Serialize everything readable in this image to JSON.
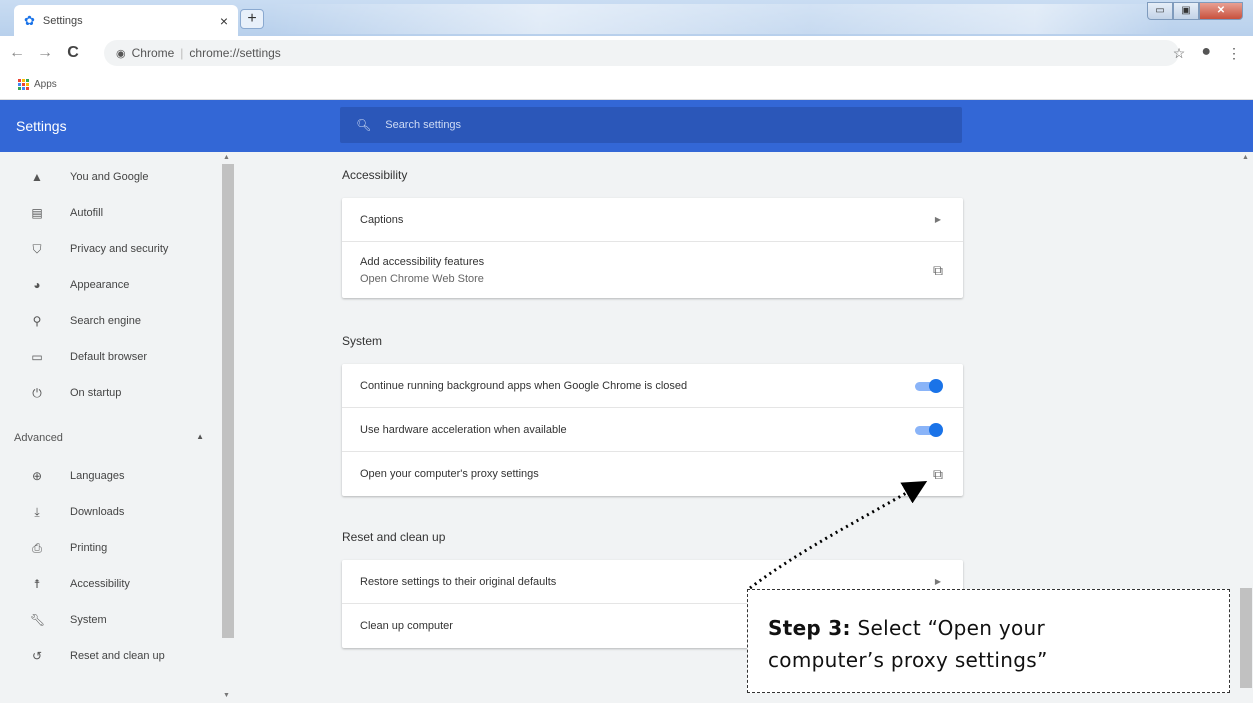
{
  "browser": {
    "tab": {
      "icon": "gear-icon",
      "title": "Settings",
      "close": "×"
    },
    "new_tab": "+",
    "window_buttons": {
      "minimize": "▭",
      "maximize": "▣",
      "close": "✕"
    },
    "toolbar": {
      "back": "←",
      "forward": "→",
      "reload": "C",
      "site_chip": "Chrome",
      "url": "chrome://settings",
      "bookmark_icon": "star-icon",
      "profile_icon": "account-icon",
      "menu_icon": "more-vert-icon"
    },
    "bookmarks": {
      "apps_label": "Apps"
    }
  },
  "header": {
    "title": "Settings",
    "search_placeholder": "Search settings"
  },
  "sidebar": {
    "items": [
      {
        "label": "You and Google",
        "icon": "person-icon"
      },
      {
        "label": "Autofill",
        "icon": "clipboard-icon"
      },
      {
        "label": "Privacy and security",
        "icon": "shield-icon"
      },
      {
        "label": "Appearance",
        "icon": "palette-icon"
      },
      {
        "label": "Search engine",
        "icon": "search-icon"
      },
      {
        "label": "Default browser",
        "icon": "browser-icon"
      },
      {
        "label": "On startup",
        "icon": "power-icon"
      }
    ],
    "advanced_label": "Advanced",
    "advanced_items": [
      {
        "label": "Languages",
        "icon": "globe-icon"
      },
      {
        "label": "Downloads",
        "icon": "download-icon"
      },
      {
        "label": "Printing",
        "icon": "printer-icon"
      },
      {
        "label": "Accessibility",
        "icon": "accessibility-icon"
      },
      {
        "label": "System",
        "icon": "wrench-icon"
      },
      {
        "label": "Reset and clean up",
        "icon": "restore-icon"
      }
    ]
  },
  "main": {
    "accessibility": {
      "title": "Accessibility",
      "captions": "Captions",
      "add_features": "Add accessibility features",
      "add_features_sub": "Open Chrome Web Store"
    },
    "system": {
      "title": "System",
      "background_apps": "Continue running background apps when Google Chrome is closed",
      "background_apps_on": true,
      "hardware_accel": "Use hardware acceleration when available",
      "hardware_accel_on": true,
      "proxy": "Open your computer's proxy settings"
    },
    "reset": {
      "title": "Reset and clean up",
      "restore": "Restore settings to their original defaults",
      "cleanup": "Clean up computer"
    }
  },
  "annotation": {
    "step_label": "Step 3:",
    "text_line1": " Select “Open your",
    "text_line2": "computer’s proxy settings”"
  },
  "colors": {
    "header_blue": "#3367d6",
    "toggle_blue": "#1a73e8"
  }
}
